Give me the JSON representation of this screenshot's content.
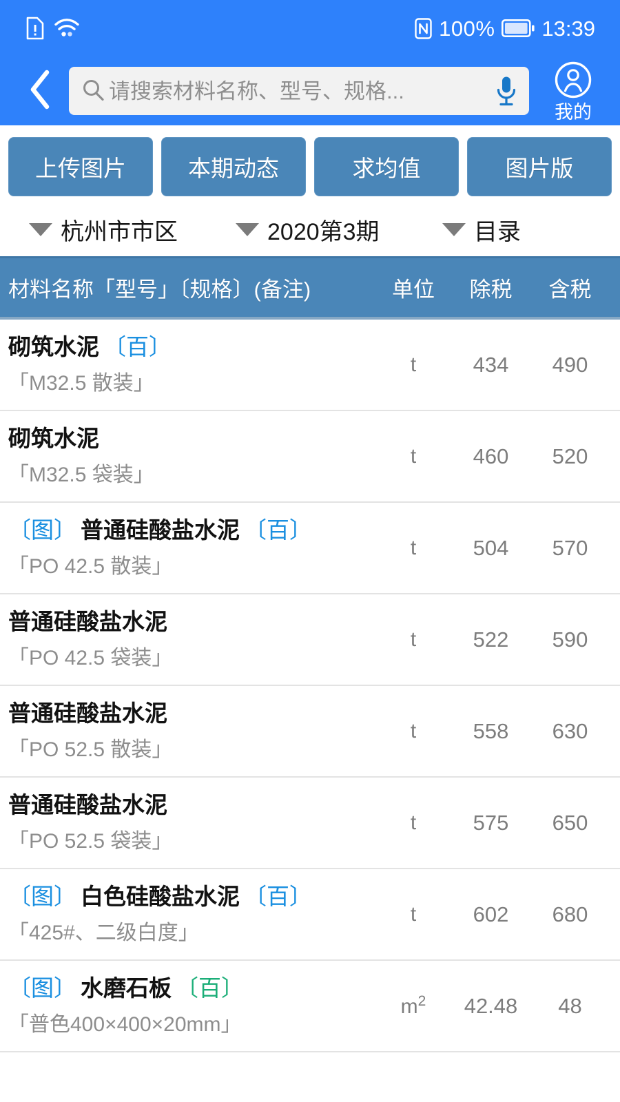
{
  "status_bar": {
    "icons_left": [
      "sim-card-alert-icon",
      "wifi-icon"
    ],
    "nfc_icon": "nfc-icon",
    "battery_percent": "100%",
    "battery_icon": "battery-full-icon",
    "time": "13:39"
  },
  "top_nav": {
    "back_icon": "back-chevron-icon",
    "search": {
      "icon": "search-icon",
      "placeholder": "请搜索材料名称、型号、规格...",
      "value": "",
      "mic_icon": "microphone-icon"
    },
    "profile": {
      "icon": "user-avatar-icon",
      "label": "我的"
    },
    "background_color": "#2e81fb"
  },
  "action_buttons": [
    {
      "label": "上传图片"
    },
    {
      "label": "本期动态"
    },
    {
      "label": "求均值"
    },
    {
      "label": "图片版"
    }
  ],
  "filters": [
    {
      "label": "杭州市市区",
      "caret": "chevron-down-icon"
    },
    {
      "label": "2020第3期",
      "caret": "chevron-down-icon"
    },
    {
      "label": "目录",
      "caret": "chevron-down-icon"
    }
  ],
  "table": {
    "header_color": "#4a86b8",
    "columns": {
      "name": "材料名称「型号」〔规格〕(备注)",
      "unit": "单位",
      "ex_tax": "除税",
      "in_tax": "含税"
    },
    "rows": [
      {
        "tu_tag": "",
        "name": "砌筑水泥",
        "bai_tag": "〔百〕",
        "bai_color": "blue",
        "spec": "「M32.5 散装」",
        "unit": "t",
        "unit_sup": "",
        "ex_tax": "434",
        "in_tax": "490"
      },
      {
        "tu_tag": "",
        "name": "砌筑水泥",
        "bai_tag": "",
        "bai_color": "blue",
        "spec": "「M32.5 袋装」",
        "unit": "t",
        "unit_sup": "",
        "ex_tax": "460",
        "in_tax": "520"
      },
      {
        "tu_tag": "〔图〕",
        "name": "普通硅酸盐水泥",
        "bai_tag": "〔百〕",
        "bai_color": "blue",
        "spec": "「PO 42.5 散装」",
        "unit": "t",
        "unit_sup": "",
        "ex_tax": "504",
        "in_tax": "570"
      },
      {
        "tu_tag": "",
        "name": "普通硅酸盐水泥",
        "bai_tag": "",
        "bai_color": "blue",
        "spec": "「PO 42.5 袋装」",
        "unit": "t",
        "unit_sup": "",
        "ex_tax": "522",
        "in_tax": "590"
      },
      {
        "tu_tag": "",
        "name": "普通硅酸盐水泥",
        "bai_tag": "",
        "bai_color": "blue",
        "spec": "「PO 52.5 散装」",
        "unit": "t",
        "unit_sup": "",
        "ex_tax": "558",
        "in_tax": "630"
      },
      {
        "tu_tag": "",
        "name": "普通硅酸盐水泥",
        "bai_tag": "",
        "bai_color": "blue",
        "spec": "「PO 52.5 袋装」",
        "unit": "t",
        "unit_sup": "",
        "ex_tax": "575",
        "in_tax": "650"
      },
      {
        "tu_tag": "〔图〕",
        "name": "白色硅酸盐水泥",
        "bai_tag": "〔百〕",
        "bai_color": "blue",
        "spec": "「425#、二级白度」",
        "unit": "t",
        "unit_sup": "",
        "ex_tax": "602",
        "in_tax": "680"
      },
      {
        "tu_tag": "〔图〕",
        "name": "水磨石板",
        "bai_tag": "〔百〕",
        "bai_color": "green",
        "spec": "「普色400×400×20mm」",
        "unit": "m",
        "unit_sup": "2",
        "ex_tax": "42.48",
        "in_tax": "48"
      }
    ]
  },
  "colors": {
    "nav_blue": "#2e81fb",
    "button_blue": "#4a86b8",
    "tag_blue": "#1a8fe0",
    "tag_green": "#1bae78",
    "text_dark": "#121212",
    "text_gray": "#8d8d8d"
  }
}
